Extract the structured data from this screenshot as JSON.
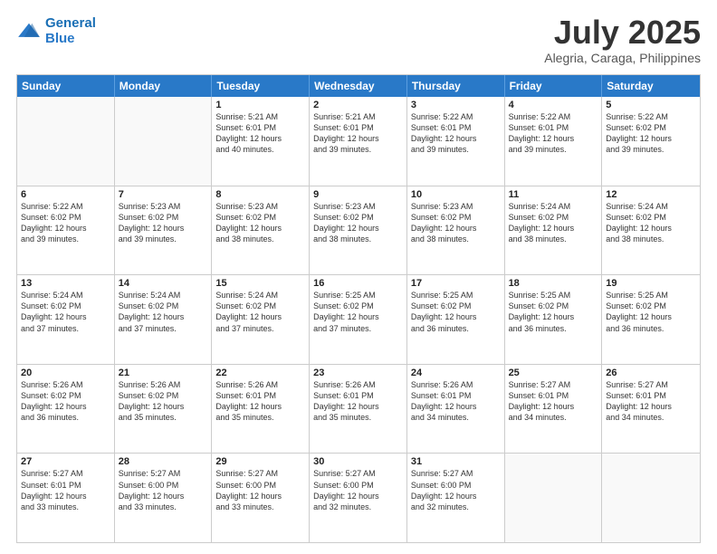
{
  "logo": {
    "line1": "General",
    "line2": "Blue"
  },
  "title": "July 2025",
  "location": "Alegria, Caraga, Philippines",
  "header_days": [
    "Sunday",
    "Monday",
    "Tuesday",
    "Wednesday",
    "Thursday",
    "Friday",
    "Saturday"
  ],
  "weeks": [
    [
      {
        "day": "",
        "info": "",
        "empty": true
      },
      {
        "day": "",
        "info": "",
        "empty": true
      },
      {
        "day": "1",
        "info": "Sunrise: 5:21 AM\nSunset: 6:01 PM\nDaylight: 12 hours\nand 40 minutes.",
        "empty": false
      },
      {
        "day": "2",
        "info": "Sunrise: 5:21 AM\nSunset: 6:01 PM\nDaylight: 12 hours\nand 39 minutes.",
        "empty": false
      },
      {
        "day": "3",
        "info": "Sunrise: 5:22 AM\nSunset: 6:01 PM\nDaylight: 12 hours\nand 39 minutes.",
        "empty": false
      },
      {
        "day": "4",
        "info": "Sunrise: 5:22 AM\nSunset: 6:01 PM\nDaylight: 12 hours\nand 39 minutes.",
        "empty": false
      },
      {
        "day": "5",
        "info": "Sunrise: 5:22 AM\nSunset: 6:02 PM\nDaylight: 12 hours\nand 39 minutes.",
        "empty": false
      }
    ],
    [
      {
        "day": "6",
        "info": "Sunrise: 5:22 AM\nSunset: 6:02 PM\nDaylight: 12 hours\nand 39 minutes.",
        "empty": false
      },
      {
        "day": "7",
        "info": "Sunrise: 5:23 AM\nSunset: 6:02 PM\nDaylight: 12 hours\nand 39 minutes.",
        "empty": false
      },
      {
        "day": "8",
        "info": "Sunrise: 5:23 AM\nSunset: 6:02 PM\nDaylight: 12 hours\nand 38 minutes.",
        "empty": false
      },
      {
        "day": "9",
        "info": "Sunrise: 5:23 AM\nSunset: 6:02 PM\nDaylight: 12 hours\nand 38 minutes.",
        "empty": false
      },
      {
        "day": "10",
        "info": "Sunrise: 5:23 AM\nSunset: 6:02 PM\nDaylight: 12 hours\nand 38 minutes.",
        "empty": false
      },
      {
        "day": "11",
        "info": "Sunrise: 5:24 AM\nSunset: 6:02 PM\nDaylight: 12 hours\nand 38 minutes.",
        "empty": false
      },
      {
        "day": "12",
        "info": "Sunrise: 5:24 AM\nSunset: 6:02 PM\nDaylight: 12 hours\nand 38 minutes.",
        "empty": false
      }
    ],
    [
      {
        "day": "13",
        "info": "Sunrise: 5:24 AM\nSunset: 6:02 PM\nDaylight: 12 hours\nand 37 minutes.",
        "empty": false
      },
      {
        "day": "14",
        "info": "Sunrise: 5:24 AM\nSunset: 6:02 PM\nDaylight: 12 hours\nand 37 minutes.",
        "empty": false
      },
      {
        "day": "15",
        "info": "Sunrise: 5:24 AM\nSunset: 6:02 PM\nDaylight: 12 hours\nand 37 minutes.",
        "empty": false
      },
      {
        "day": "16",
        "info": "Sunrise: 5:25 AM\nSunset: 6:02 PM\nDaylight: 12 hours\nand 37 minutes.",
        "empty": false
      },
      {
        "day": "17",
        "info": "Sunrise: 5:25 AM\nSunset: 6:02 PM\nDaylight: 12 hours\nand 36 minutes.",
        "empty": false
      },
      {
        "day": "18",
        "info": "Sunrise: 5:25 AM\nSunset: 6:02 PM\nDaylight: 12 hours\nand 36 minutes.",
        "empty": false
      },
      {
        "day": "19",
        "info": "Sunrise: 5:25 AM\nSunset: 6:02 PM\nDaylight: 12 hours\nand 36 minutes.",
        "empty": false
      }
    ],
    [
      {
        "day": "20",
        "info": "Sunrise: 5:26 AM\nSunset: 6:02 PM\nDaylight: 12 hours\nand 36 minutes.",
        "empty": false
      },
      {
        "day": "21",
        "info": "Sunrise: 5:26 AM\nSunset: 6:02 PM\nDaylight: 12 hours\nand 35 minutes.",
        "empty": false
      },
      {
        "day": "22",
        "info": "Sunrise: 5:26 AM\nSunset: 6:01 PM\nDaylight: 12 hours\nand 35 minutes.",
        "empty": false
      },
      {
        "day": "23",
        "info": "Sunrise: 5:26 AM\nSunset: 6:01 PM\nDaylight: 12 hours\nand 35 minutes.",
        "empty": false
      },
      {
        "day": "24",
        "info": "Sunrise: 5:26 AM\nSunset: 6:01 PM\nDaylight: 12 hours\nand 34 minutes.",
        "empty": false
      },
      {
        "day": "25",
        "info": "Sunrise: 5:27 AM\nSunset: 6:01 PM\nDaylight: 12 hours\nand 34 minutes.",
        "empty": false
      },
      {
        "day": "26",
        "info": "Sunrise: 5:27 AM\nSunset: 6:01 PM\nDaylight: 12 hours\nand 34 minutes.",
        "empty": false
      }
    ],
    [
      {
        "day": "27",
        "info": "Sunrise: 5:27 AM\nSunset: 6:01 PM\nDaylight: 12 hours\nand 33 minutes.",
        "empty": false
      },
      {
        "day": "28",
        "info": "Sunrise: 5:27 AM\nSunset: 6:00 PM\nDaylight: 12 hours\nand 33 minutes.",
        "empty": false
      },
      {
        "day": "29",
        "info": "Sunrise: 5:27 AM\nSunset: 6:00 PM\nDaylight: 12 hours\nand 33 minutes.",
        "empty": false
      },
      {
        "day": "30",
        "info": "Sunrise: 5:27 AM\nSunset: 6:00 PM\nDaylight: 12 hours\nand 32 minutes.",
        "empty": false
      },
      {
        "day": "31",
        "info": "Sunrise: 5:27 AM\nSunset: 6:00 PM\nDaylight: 12 hours\nand 32 minutes.",
        "empty": false
      },
      {
        "day": "",
        "info": "",
        "empty": true
      },
      {
        "day": "",
        "info": "",
        "empty": true
      }
    ]
  ]
}
